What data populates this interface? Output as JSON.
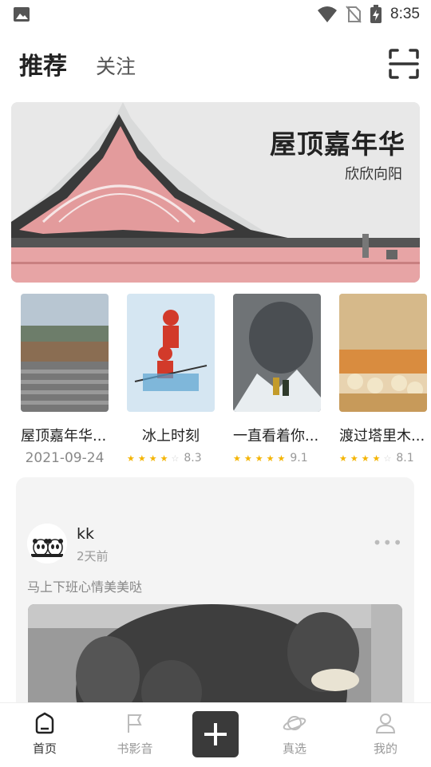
{
  "status_bar": {
    "time": "8:35",
    "icons": [
      "image-icon",
      "wifi-icon",
      "no-sim-icon",
      "battery-charging-icon"
    ]
  },
  "header": {
    "tabs": [
      {
        "label": "推荐",
        "active": true
      },
      {
        "label": "关注",
        "active": false
      }
    ],
    "scan_icon": "scan-icon"
  },
  "banner": {
    "title": "屋顶嘉年华",
    "subtitle": "欣欣向阳"
  },
  "movies": [
    {
      "title": "屋顶嘉年华...",
      "date": "2021-09-24"
    },
    {
      "title": "冰上时刻",
      "rating": "8.3",
      "stars": 4
    },
    {
      "title": "一直看着你...",
      "rating": "9.1",
      "stars": 4.5
    },
    {
      "title": "渡过塔里木...",
      "rating": "8.1",
      "stars": 4
    }
  ],
  "post": {
    "username": "kk",
    "time": "2天前",
    "text": "马上下班心情美美哒",
    "more_icon": "more-dots-icon"
  },
  "bottom_nav": {
    "items": [
      {
        "label": "首页",
        "icon": "home-icon",
        "active": true
      },
      {
        "label": "书影音",
        "icon": "flag-icon",
        "active": false
      },
      {
        "label": "",
        "icon": "plus-icon",
        "active": false
      },
      {
        "label": "真选",
        "icon": "planet-icon",
        "active": false
      },
      {
        "label": "我的",
        "icon": "user-icon",
        "active": false
      }
    ]
  },
  "colors": {
    "accent_dark": "#3a3a3a",
    "star": "#f4b400",
    "card_bg": "#f4f4f4"
  }
}
